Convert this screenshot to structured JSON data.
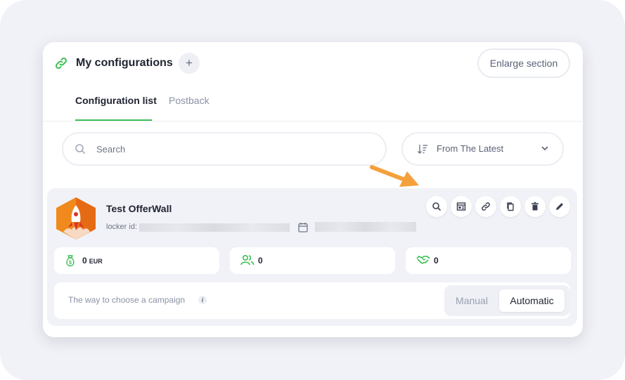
{
  "header": {
    "title": "My configurations",
    "add_label": "+",
    "enlarge_label": "Enlarge section"
  },
  "tabs": [
    {
      "label": "Configuration list",
      "active": true
    },
    {
      "label": "Postback",
      "active": false
    }
  ],
  "search": {
    "placeholder": "Search",
    "value": ""
  },
  "sort": {
    "selected": "From The Latest"
  },
  "card": {
    "title": "Test OfferWall",
    "locker_label": "locker id:",
    "actions": [
      "search-icon",
      "preview-icon",
      "link-icon",
      "copy-icon",
      "trash-icon",
      "edit-icon"
    ],
    "stats": {
      "revenue_value": "0",
      "revenue_currency": "EUR",
      "users_value": "0",
      "conversions_value": "0"
    },
    "campaign": {
      "label": "The way to choose a campaign",
      "info_icon": "i",
      "options": [
        "Manual",
        "Automatic"
      ],
      "selected": "Automatic"
    }
  },
  "colors": {
    "accent": "#3cbf55",
    "annotation_arrow": "#f5a03a",
    "background": "#f1f2f7"
  }
}
